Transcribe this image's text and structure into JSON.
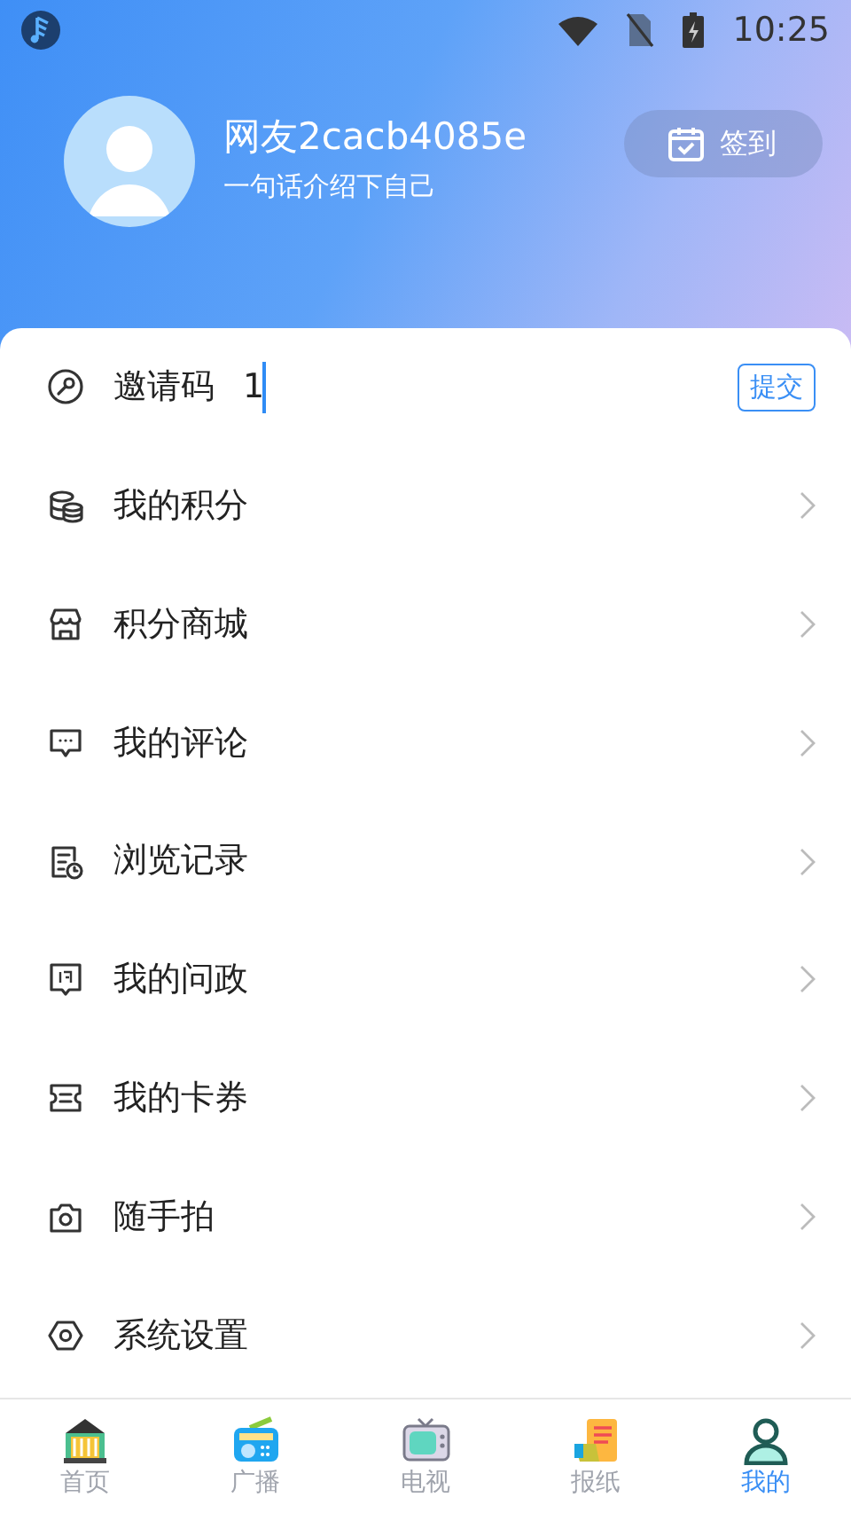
{
  "status_bar": {
    "time": "10:25"
  },
  "profile": {
    "name": "网友2cacb4085e",
    "bio": "一句话介绍下自己",
    "checkin_button": "签到"
  },
  "menu": [
    {
      "kind": "input",
      "label": "邀请码",
      "value": "1",
      "button": "提交"
    },
    {
      "kind": "link",
      "label": "我的积分"
    },
    {
      "kind": "link",
      "label": "积分商城"
    },
    {
      "kind": "link",
      "label": "我的评论"
    },
    {
      "kind": "link",
      "label": "浏览记录"
    },
    {
      "kind": "link",
      "label": "我的问政"
    },
    {
      "kind": "link",
      "label": "我的卡券"
    },
    {
      "kind": "link",
      "label": "随手拍"
    },
    {
      "kind": "link",
      "label": "系统设置"
    }
  ],
  "tabs": [
    {
      "label": "首页",
      "selected": false
    },
    {
      "label": "广播",
      "selected": false
    },
    {
      "label": "电视",
      "selected": false
    },
    {
      "label": "报纸",
      "selected": false
    },
    {
      "label": "我的",
      "selected": true
    }
  ]
}
